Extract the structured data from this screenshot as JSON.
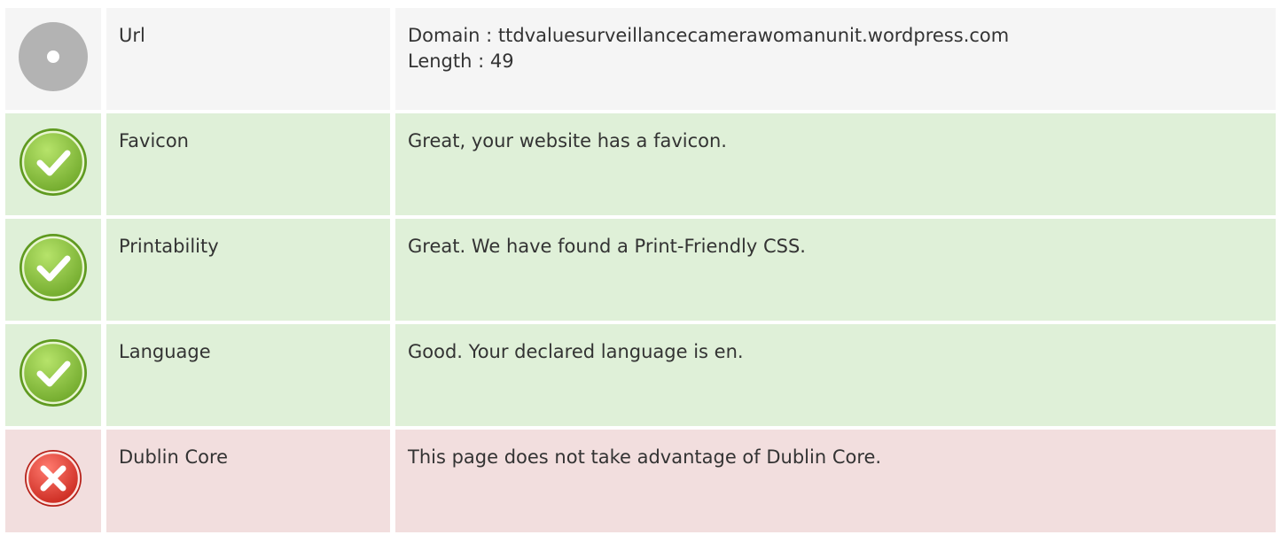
{
  "rows": [
    {
      "status": "neutral",
      "icon": "info-neutral-icon",
      "label": "Url",
      "lines": [
        "Domain : ttdvaluesurveillancecamerawomanunit.wordpress.com",
        "Length : 49"
      ]
    },
    {
      "status": "good",
      "icon": "check-circle-icon",
      "label": "Favicon",
      "lines": [
        "Great, your website has a favicon."
      ]
    },
    {
      "status": "good",
      "icon": "check-circle-icon",
      "label": "Printability",
      "lines": [
        "Great. We have found a Print-Friendly CSS."
      ]
    },
    {
      "status": "good",
      "icon": "check-circle-icon",
      "label": "Language",
      "lines": [
        "Good. Your declared language is en."
      ]
    },
    {
      "status": "bad",
      "icon": "error-x-circle-icon",
      "label": "Dublin Core",
      "lines": [
        "This page does not take advantage of Dublin Core."
      ]
    }
  ],
  "colors": {
    "neutral_bg": "#f5f5f5",
    "good_bg": "#dff0d8",
    "bad_bg": "#f2dede",
    "good_icon": "#8cc63f",
    "bad_icon": "#e0403a",
    "neutral_icon": "#b3b3b3"
  }
}
